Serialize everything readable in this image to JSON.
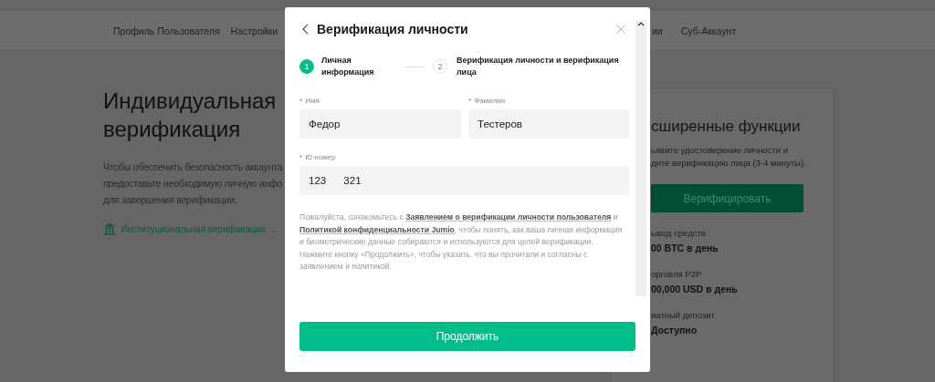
{
  "nav": {
    "items": [
      {
        "label": "Профиль Пользователя"
      },
      {
        "label": "Настройки"
      },
      {
        "label": "ии",
        "kind": "partial"
      },
      {
        "label": "Суб-Аккаунт"
      }
    ]
  },
  "intro": {
    "title": "Индивидуальная верификация",
    "lines": [
      "Чтобы обеспечить безопасность аккаунта",
      "предоставьте необходимую личную инфо",
      "для завершения верификации."
    ],
    "link": "Институциональная верификация →"
  },
  "card": {
    "title": "сширенные функции",
    "lines": [
      "ьявите удостоверение личности и",
      "дите верификацию лица (3-4 минуты)."
    ],
    "button": "Верифицировать",
    "limits": [
      {
        "label": "ывод средств",
        "value": "00 BTC в день"
      },
      {
        "label": "орговля P2P",
        "value": "00,000 USD в день"
      },
      {
        "label": "иатный депозит",
        "value": "Доступно"
      }
    ]
  },
  "dialog": {
    "title": "Верификация личности",
    "steps": [
      {
        "number": "1",
        "label": "Личная информация",
        "selected": true
      },
      {
        "number": "2",
        "label": "Верификация личности и верификация лица",
        "selected": false
      }
    ],
    "fields": [
      {
        "mark": "*",
        "label": "Имя",
        "value": "Федор"
      },
      {
        "mark": "*",
        "label": "Фамилия",
        "value": "Тестеров"
      },
      {
        "mark": "*",
        "label": "ID номер",
        "value": "123      321"
      }
    ],
    "notice": [
      {
        "kind": "text",
        "text": "Пожалуйста, ознакомьтесь с "
      },
      {
        "kind": "link",
        "text": "Заявлением о верификации личности пользователя"
      },
      {
        "kind": "text",
        "text": " и "
      },
      {
        "kind": "link",
        "text": "Политикой конфиденциальности Jumio"
      },
      {
        "kind": "text",
        "text": ", чтобы понять, как ваша личная информация и биометрические данные собираются и используются для целей верификации. Нажмите кнопку «Продолжить», чтобы указать, что вы прочитали и согласны с заявлением и политикой."
      }
    ],
    "button": "Продолжить"
  }
}
